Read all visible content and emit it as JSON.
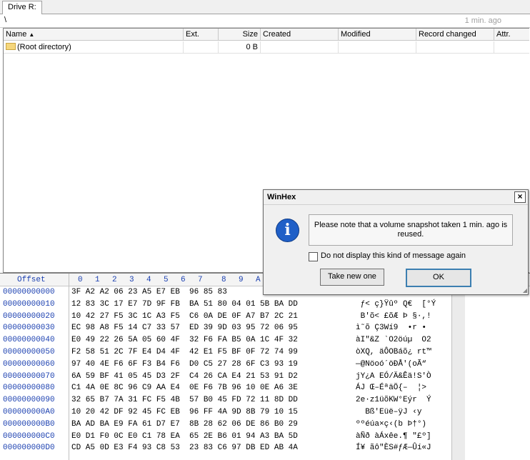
{
  "tab": {
    "label": "Drive R:"
  },
  "path": {
    "text": "\\",
    "age": "1 min. ago"
  },
  "columns": [
    {
      "key": "name",
      "label": "Name"
    },
    {
      "key": "ext",
      "label": "Ext."
    },
    {
      "key": "size",
      "label": "Size"
    },
    {
      "key": "created",
      "label": "Created"
    },
    {
      "key": "modified",
      "label": "Modified"
    },
    {
      "key": "record",
      "label": "Record changed"
    },
    {
      "key": "attr",
      "label": "Attr."
    }
  ],
  "files": [
    {
      "name": "(Root directory)",
      "ext": "",
      "size": "0 B",
      "created": "",
      "modified": "",
      "record": "",
      "attr": ""
    }
  ],
  "hex": {
    "offset_label": "Offset",
    "col_labels": [
      "0",
      "1",
      "2",
      "3",
      "4",
      "5",
      "6",
      "7",
      "8",
      "9",
      "A"
    ],
    "rows": [
      {
        "offset": "00000000000",
        "bytes": "3F A2 A2 06 23 A5 E7 EB  96 85 83",
        "ascii": ""
      },
      {
        "offset": "00000000010",
        "bytes": "12 83 3C 17 E7 7D 9F FB  BA 51 80 04 01 5B BA DD",
        "ascii": " ƒ< ç}Ÿûº Q€  [°Ý"
      },
      {
        "offset": "00000000020",
        "bytes": "10 42 27 F5 3C 1C A3 F5  C6 0A DE 0F A7 B7 2C 21",
        "ascii": " B'õ< £õÆ Þ §·,!"
      },
      {
        "offset": "00000000030",
        "bytes": "EC 98 A8 F5 14 C7 33 57  ED 39 9D 03 95 72 06 95",
        "ascii": "ì˜õ Ç3Wí9  •r •"
      },
      {
        "offset": "00000000040",
        "bytes": "E0 49 22 26 5A 05 60 4F  32 F6 FA B5 0A 1C 4F 32",
        "ascii": "àI\"&Z `O2öúµ  O2"
      },
      {
        "offset": "00000000050",
        "bytes": "F2 58 51 2C 7F E4 D4 4F  42 E1 F5 BF 0F 72 74 99",
        "ascii": "òXQ, äÔOBáõ¿ rt™"
      },
      {
        "offset": "00000000060",
        "bytes": "97 40 4E F6 6F F3 B4 F6  D0 C5 27 28 6F C3 93 19",
        "ascii": "—@Nöoó´öÐÅ'(oÃ“"
      },
      {
        "offset": "00000000070",
        "bytes": "6A 59 BF 41 05 45 D3 2F  C4 26 CA E4 21 53 91 D2",
        "ascii": "jY¿A EÓ/Ä&Êä!S'Ò"
      },
      {
        "offset": "00000000080",
        "bytes": "C1 4A 0E 8C 96 C9 AA E4  0E F6 7B 96 10 0E A6 3E",
        "ascii": "ÁJ Œ–ÉªäÖ{–  ¦>"
      },
      {
        "offset": "00000000090",
        "bytes": "32 65 B7 7A 31 FC F5 4B  57 B0 45 FD 72 11 8D DD",
        "ascii": "2e·z1üõKW°Eýr  Ý"
      },
      {
        "offset": "000000000A0",
        "bytes": "10 20 42 DF 92 45 FC EB  96 FF 4A 9D 8B 79 10 15",
        "ascii": "  Bß'Eüë–ÿJ ‹y"
      },
      {
        "offset": "000000000B0",
        "bytes": "BA AD BA E9 FA 61 D7 E7  8B 28 62 06 DE 86 B0 29",
        "ascii": "º­ºéúa×ç‹(b Þ†°)"
      },
      {
        "offset": "000000000C0",
        "bytes": "E0 D1 F0 0C E0 C1 78 EA  65 2E B6 01 94 A3 BA 5D",
        "ascii": "àÑð àÁxêe.¶ \"£º]"
      },
      {
        "offset": "000000000D0",
        "bytes": "CD A5 0D E3 F4 93 C8 53  23 83 C6 97 DB ED AB 4A",
        "ascii": "Í¥ ãô\"ÈS#ƒÆ—Ûí«J"
      }
    ]
  },
  "dialog": {
    "title": "WinHex",
    "close": "×",
    "icon": "info-icon",
    "message": "Please note that a volume snapshot taken 1 min. ago is reused.",
    "checkbox_label": "Do not display this kind of message again",
    "take_new_label": "Take new one",
    "ok_label": "OK"
  }
}
